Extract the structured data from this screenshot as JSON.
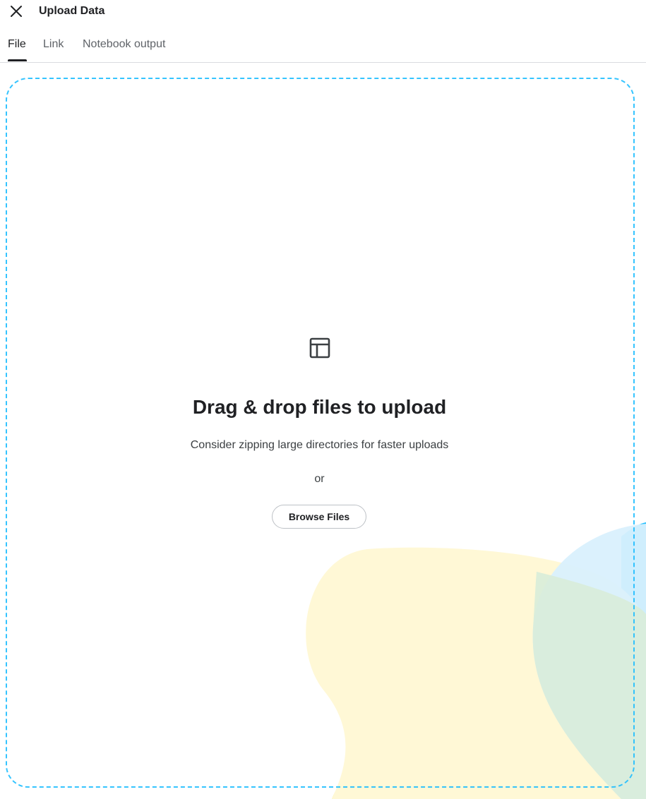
{
  "header": {
    "title": "Upload Data",
    "close_icon": "close-icon"
  },
  "tabs": [
    {
      "label": "File",
      "active": true
    },
    {
      "label": "Link",
      "active": false
    },
    {
      "label": "Notebook output",
      "active": false
    }
  ],
  "dropzone": {
    "icon": "table-icon",
    "heading": "Drag & drop files to upload",
    "hint": "Consider zipping large directories for faster uploads",
    "or_text": "or",
    "browse_label": "Browse Files"
  },
  "colors": {
    "dropzone_border": "#20beff",
    "blob_yellow": "#fff8d6",
    "blob_blue": "#d9f0fd",
    "accent_blue": "#20beff",
    "accent_green": "#1fad4a",
    "accent_yellow": "#fbe43f"
  }
}
